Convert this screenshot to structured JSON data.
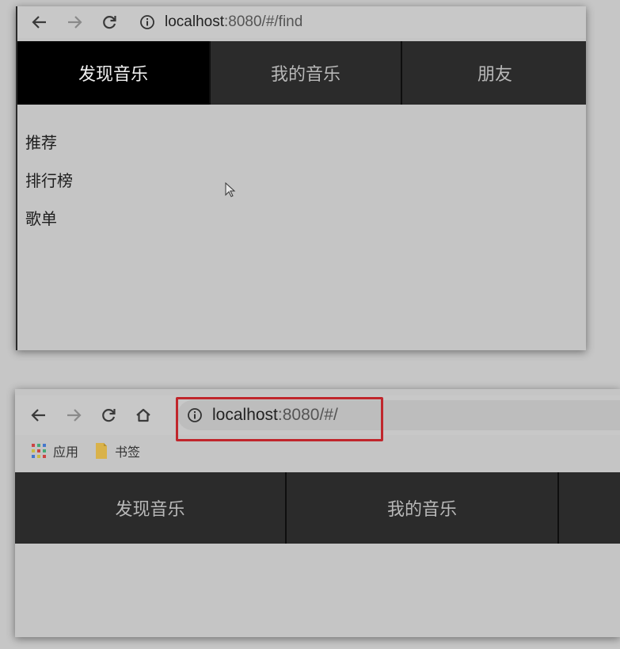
{
  "screenshot_top": {
    "url_host": "localhost",
    "url_rest": ":8080/#/find",
    "nav_tabs": [
      {
        "label": "发现音乐",
        "active": true
      },
      {
        "label": "我的音乐",
        "active": false
      },
      {
        "label": "朋友",
        "active": false
      }
    ],
    "sub_items": [
      "推荐",
      "排行榜",
      "歌单"
    ]
  },
  "screenshot_bottom": {
    "url_host": "localhost",
    "url_rest": ":8080/#/",
    "bookmarks": [
      "应用",
      "书签"
    ],
    "nav_tabs": [
      {
        "label": "发现音乐",
        "active": false
      },
      {
        "label": "我的音乐",
        "active": false
      },
      {
        "label": "",
        "active": false
      }
    ],
    "highlight_color": "#c0262c"
  },
  "icons": [
    "back-arrow-icon",
    "forward-arrow-icon",
    "reload-icon",
    "home-icon",
    "info-icon",
    "apps-grid-icon",
    "bookmark-folder-icon",
    "mouse-cursor-icon"
  ]
}
